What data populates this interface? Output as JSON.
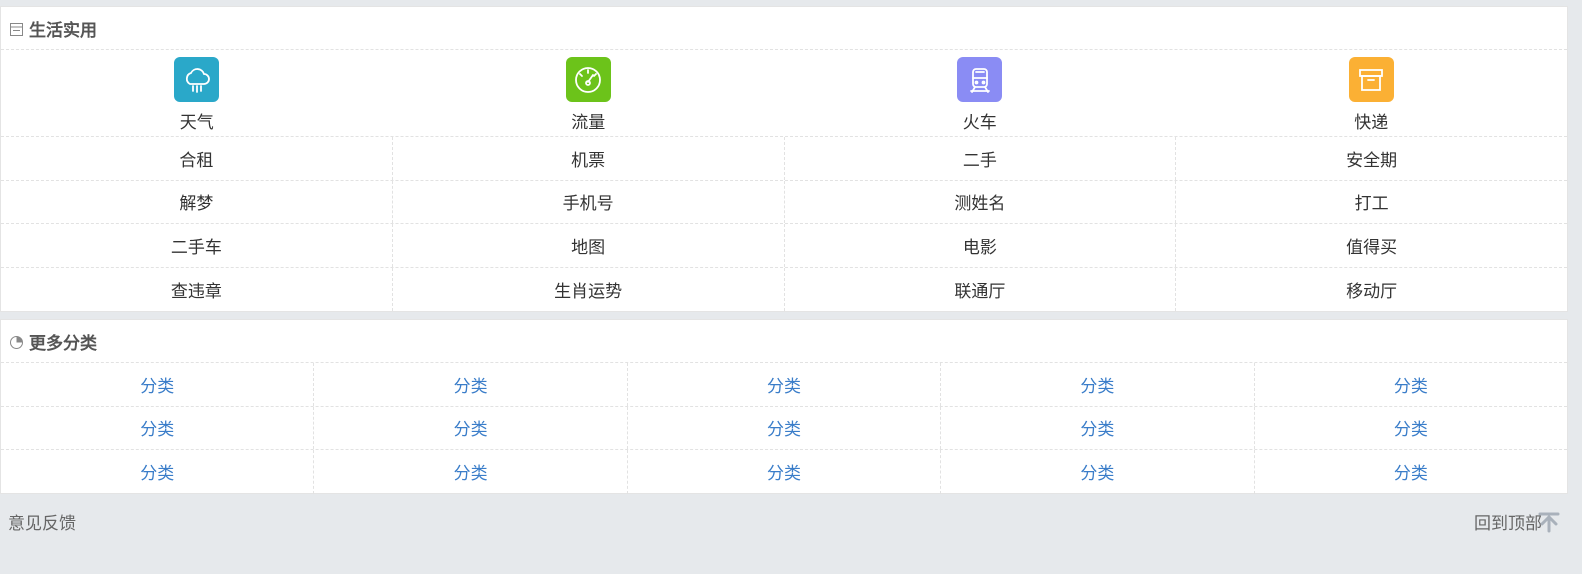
{
  "life_section": {
    "title": "生活实用",
    "features": [
      {
        "label": "天气",
        "icon": "cloud-rain-icon",
        "color": "#2aa8c9"
      },
      {
        "label": "流量",
        "icon": "speedometer-icon",
        "color": "#6cc31a"
      },
      {
        "label": "火车",
        "icon": "train-icon",
        "color": "#8a8cf4"
      },
      {
        "label": "快递",
        "icon": "box-icon",
        "color": "#fbb034"
      }
    ],
    "rows": [
      [
        "合租",
        "机票",
        "二手",
        "安全期"
      ],
      [
        "解梦",
        "手机号",
        "测姓名",
        "打工"
      ],
      [
        "二手车",
        "地图",
        "电影",
        "值得买"
      ],
      [
        "查违章",
        "生肖运势",
        "联通厅",
        "移动厅"
      ]
    ]
  },
  "more_section": {
    "title": "更多分类",
    "rows": [
      [
        "分类",
        "分类",
        "分类",
        "分类",
        "分类"
      ],
      [
        "分类",
        "分类",
        "分类",
        "分类",
        "分类"
      ],
      [
        "分类",
        "分类",
        "分类",
        "分类",
        "分类"
      ]
    ]
  },
  "footer": {
    "feedback": "意见反馈",
    "back_to_top": "回到顶部"
  },
  "colors": {
    "link_blue": "#3a7dc9",
    "background": "#e6e9ec"
  }
}
